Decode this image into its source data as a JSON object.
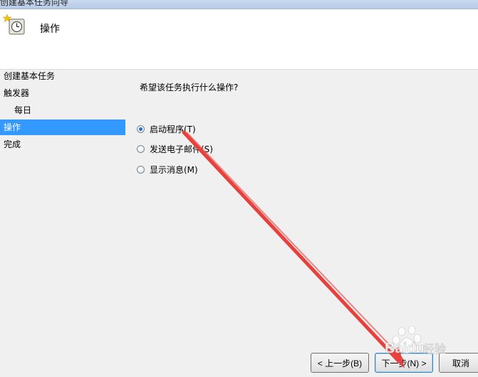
{
  "window": {
    "title": "创建基本任务向导"
  },
  "header": {
    "title": "操作",
    "icon": "task-scheduler-clock-icon"
  },
  "sidebar": {
    "items": [
      {
        "label": "创建基本任务",
        "selected": false,
        "sub": false
      },
      {
        "label": "触发器",
        "selected": false,
        "sub": false
      },
      {
        "label": "每日",
        "selected": false,
        "sub": true
      },
      {
        "label": "操作",
        "selected": true,
        "sub": false
      },
      {
        "label": "完成",
        "selected": false,
        "sub": false
      }
    ]
  },
  "main": {
    "question": "希望该任务执行什么操作?",
    "options": [
      {
        "label": "启动程序(T)",
        "checked": true
      },
      {
        "label": "发送电子邮件(S)",
        "checked": false
      },
      {
        "label": "显示消息(M)",
        "checked": false
      }
    ]
  },
  "footer": {
    "back_label": "< 上一步(B)",
    "next_label": "下一步(N) >",
    "cancel_label": "取消"
  },
  "annotation": {
    "arrow_color": "#e8403c"
  },
  "watermark": {
    "brand": "Baidu",
    "subtitle": "经验"
  }
}
